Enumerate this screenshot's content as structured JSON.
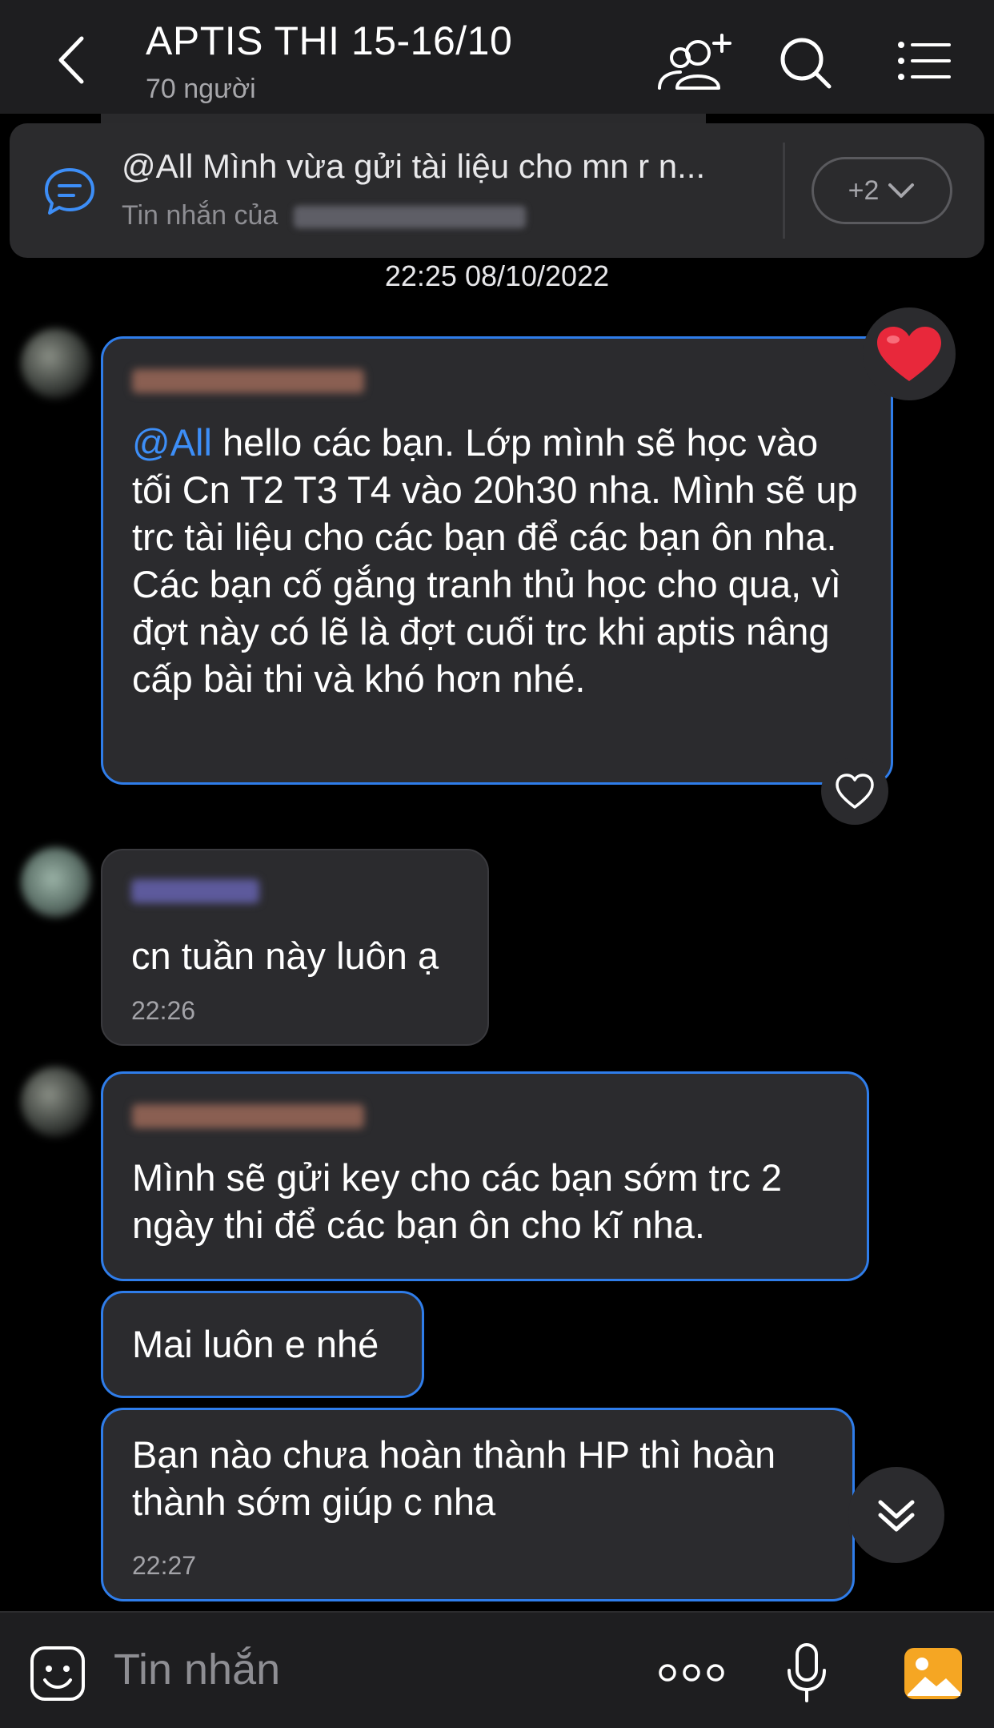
{
  "header": {
    "title": "APTIS THI 15-16/10",
    "subtitle": "70 người"
  },
  "pinned": {
    "text": "@All  Mình vừa gửi tài liệu cho mn r n...",
    "sub_prefix": "Tin nhắn của",
    "more_label": "+2"
  },
  "date_stamp": "22:25 08/10/2022",
  "messages": [
    {
      "mention": "@All",
      "text": " hello các bạn. Lớp mình sẽ học vào tối Cn T2 T3 T4 vào 20h30 nha. Mình sẽ up trc tài liệu cho các bạn để các bạn ôn nha. Các bạn cố gắng tranh thủ học cho qua, vì đợt này có lẽ là đợt cuối trc khi aptis nâng cấp bài thi và khó hơn nhé."
    },
    {
      "text": "cn tuần này luôn ạ",
      "time": "22:26"
    },
    {
      "text": "Mình sẽ gửi key cho các bạn sớm trc 2 ngày thi để các bạn ôn cho kĩ nha."
    },
    {
      "text": "Mai luôn e nhé"
    },
    {
      "text": "Bạn nào chưa hoàn thành HP thì hoàn thành sớm giúp c nha",
      "time": "22:27"
    }
  ],
  "input": {
    "placeholder": "Tin nhắn"
  },
  "colors": {
    "accent": "#2f7dea",
    "mention": "#3d8ef7",
    "heart": "#e8283b",
    "gallery": "#f5a623"
  }
}
